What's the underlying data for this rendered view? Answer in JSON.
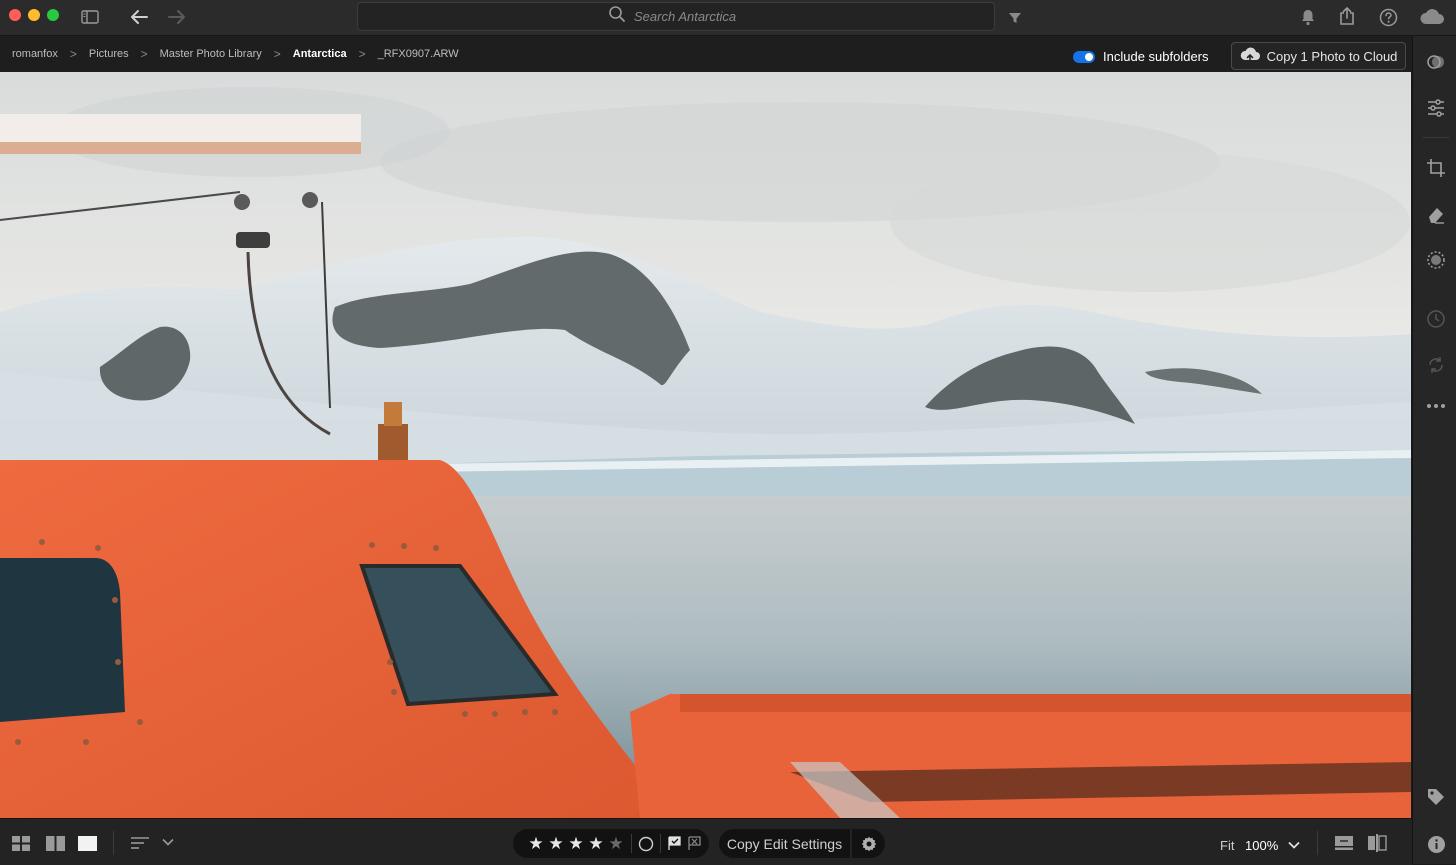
{
  "topbar": {
    "search_placeholder": "Search Antarctica"
  },
  "breadcrumb": {
    "items": [
      "romanfox",
      "Pictures",
      "Master Photo Library",
      "Antarctica",
      "_RFX0907.ARW"
    ],
    "separator": ">"
  },
  "subfolders": {
    "label": "Include subfolders",
    "enabled": true
  },
  "cloud_button": {
    "label": "Copy 1 Photo to Cloud"
  },
  "bottombar": {
    "rating": 4,
    "max_rating": 5,
    "copy_edit_label": "Copy Edit Settings",
    "fit_label": "Fit",
    "zoom_label": "100%"
  },
  "colors": {
    "accent": "#1473e6",
    "lifeboat_orange": "#e8633a",
    "background": "#1b1b1b"
  }
}
